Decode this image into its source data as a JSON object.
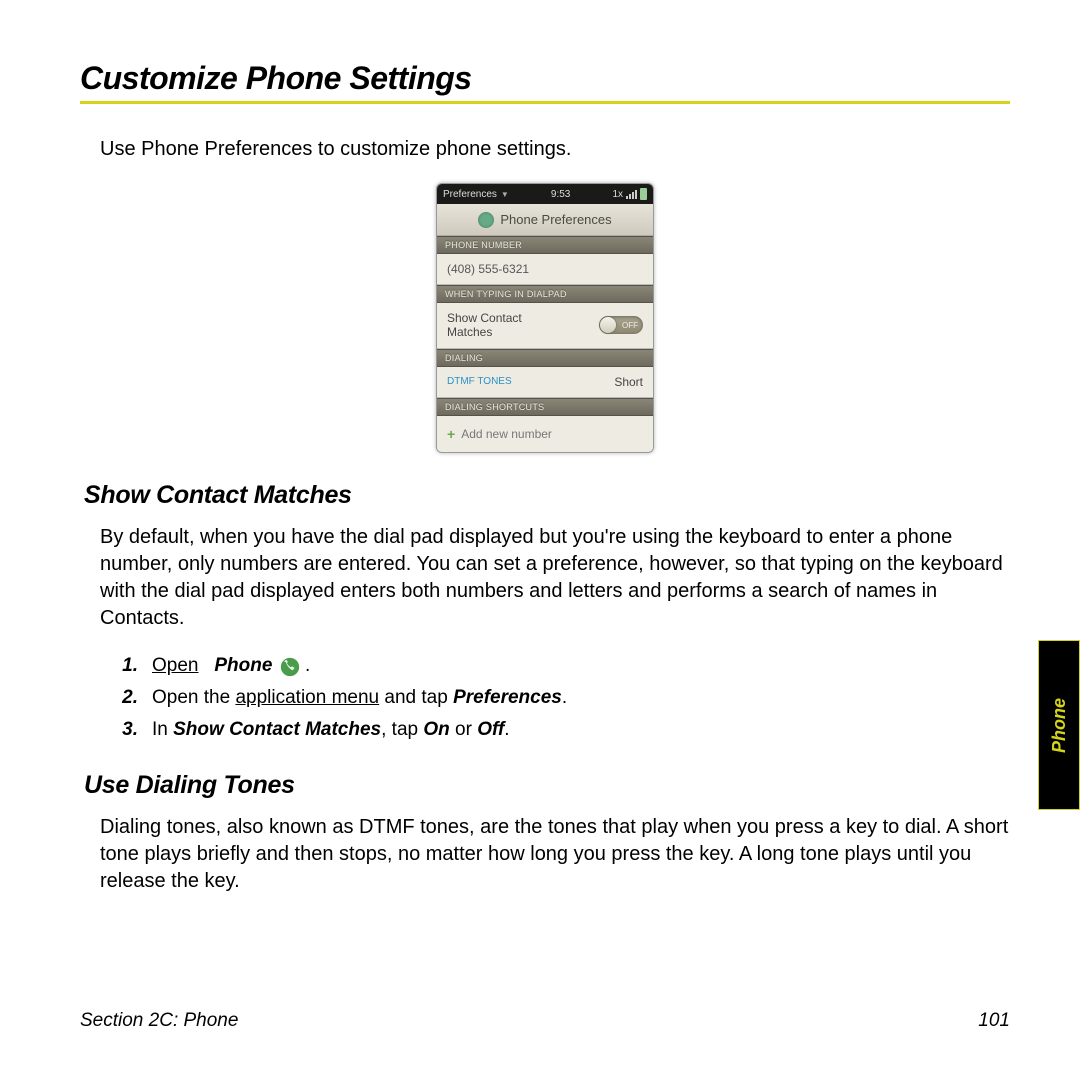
{
  "title": "Customize Phone Settings",
  "intro": "Use Phone Preferences to customize phone settings.",
  "screenshot": {
    "statusbar": {
      "left": "Preferences",
      "time": "9:53",
      "carrier_indicator": "1x"
    },
    "header": "Phone Preferences",
    "sections": {
      "phone_number": {
        "label": "PHONE NUMBER",
        "value": "(408) 555-6321"
      },
      "when_typing": {
        "label": "WHEN TYPING IN DIALPAD",
        "row_label": "Show Contact Matches",
        "toggle": "OFF"
      },
      "dialing": {
        "label": "DIALING",
        "row_label": "DTMF TONES",
        "row_value": "Short"
      },
      "shortcuts": {
        "label": "DIALING SHORTCUTS",
        "add_label": "Add new number"
      }
    }
  },
  "sections": {
    "show_contact_matches": {
      "heading": "Show Contact Matches",
      "paragraph": "By default, when you have the dial pad displayed but you're using the keyboard to enter a phone number, only numbers are entered. You can set a preference, however, so that typing on the keyboard with the dial pad displayed enters both numbers and letters and performs a search of names in Contacts.",
      "steps": {
        "s1": {
          "num": "1.",
          "pre": "Open",
          "link": "Phone",
          "post": "."
        },
        "s2": {
          "num": "2.",
          "t1": "Open the ",
          "u1": "application menu",
          "t2": " and tap ",
          "b1": "Preferences",
          "t3": "."
        },
        "s3": {
          "num": "3.",
          "t1": "In ",
          "b1": "Show Contact Matches",
          "t2": ", tap ",
          "b2": "On",
          "t3": " or ",
          "b3": "Off",
          "t4": "."
        }
      }
    },
    "use_dialing_tones": {
      "heading": "Use Dialing Tones",
      "paragraph": "Dialing tones, also known as DTMF tones, are the tones that play when you press a key to dial. A short tone plays briefly and then stops, no matter how long you press the key. A long tone plays until you release the key."
    }
  },
  "side_tab": "Phone",
  "footer": {
    "section": "Section 2C: Phone",
    "page": "101"
  }
}
